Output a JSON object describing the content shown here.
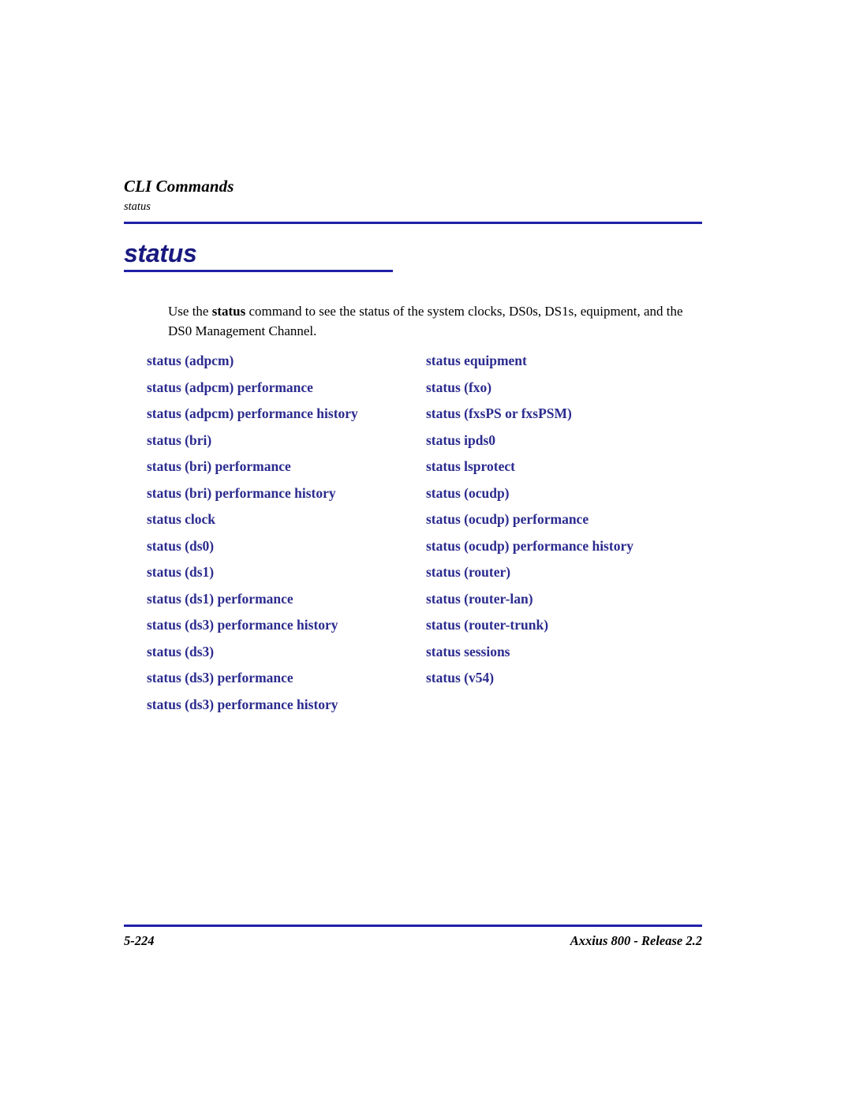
{
  "page": {
    "background": "#ffffff",
    "rule_color": "#2020a8",
    "link_color": "#2b2b8f",
    "heading_color": "#191980"
  },
  "header": {
    "chapter": "CLI Commands",
    "topic": "status"
  },
  "section": {
    "heading": "status"
  },
  "intro": {
    "before": "Use the ",
    "command": "status",
    "after": " command to see the status of the system clocks, DS0s, DS1s, equipment, and the DS0 Management Channel."
  },
  "links": {
    "left_column": [
      {
        "label": "status (adpcm)"
      },
      {
        "label": "status (adpcm) performance"
      },
      {
        "label": "status (adpcm) performance history"
      },
      {
        "label": "status (bri)"
      },
      {
        "label": "status (bri) performance"
      },
      {
        "label": "status (bri) performance history"
      },
      {
        "label": "status clock"
      },
      {
        "label": "status (ds0)"
      },
      {
        "label": "status (ds1)"
      },
      {
        "label": "status (ds1) performance"
      },
      {
        "label": "status (ds3) performance history"
      },
      {
        "label": "status (ds3)"
      },
      {
        "label": "status (ds3) performance"
      },
      {
        "label": "status (ds3) performance history"
      }
    ],
    "right_column": [
      {
        "label": "status equipment"
      },
      {
        "label": "status (fxo)"
      },
      {
        "label": "status (fxsPS or fxsPSM)"
      },
      {
        "label": "status ipds0"
      },
      {
        "label": "status lsprotect"
      },
      {
        "label": "status (ocudp)"
      },
      {
        "label": "status (ocudp) performance"
      },
      {
        "label": "status (ocudp) performance history"
      },
      {
        "label": "status (router)"
      },
      {
        "label": "status (router-lan)"
      },
      {
        "label": "status (router-trunk)"
      },
      {
        "label": "status sessions"
      },
      {
        "label": "status (v54)"
      }
    ]
  },
  "footer": {
    "page_number": "5-224",
    "product": "Axxius 800 - Release 2.2"
  }
}
